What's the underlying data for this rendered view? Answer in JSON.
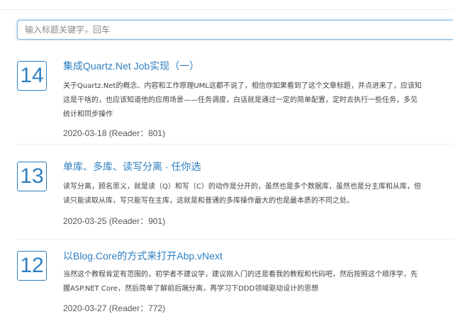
{
  "search": {
    "placeholder": "输入标题关键字，回车"
  },
  "articles": [
    {
      "number": "14",
      "title": "集成Quartz.Net Job实现（一）",
      "summary_lines": [
        "关于Quartz.Net的概念、内容和工作原理UML这都不说了，相信你如果看到了这个文章标题，并点进来了，应该知",
        "这是干啥的，也应该知道他的应用场景——任务调度，白话就是通过一定的简单配置，定时去执行一些任务，多见",
        "统计和同步操作"
      ],
      "date": "2020-03-18",
      "reader_label": "(Reader：801)"
    },
    {
      "number": "13",
      "title": "单库、多库、读写分离 · 任你选",
      "summary_lines": [
        "读写分离，顾名思义，就是读（Q）和写（C）的动作是分开的，虽然也是多个数据库，虽然也是分主库和从库，但",
        "读只能读取从库，写只能写在主库，这就是和普通的多库操作最大的也是最本质的不同之处。"
      ],
      "date": "2020-03-25",
      "reader_label": "(Reader：901)"
    },
    {
      "number": "12",
      "title": "以Blog.Core的方式来打开Abp.vNext",
      "summary_lines": [
        "当然这个教程肯定有范围的，初学者不建议学，建议刚入门的还是看我的教程和代码吧，然后按照这个顺序学，先",
        "握ASP.NET Core，然后简单了解前后端分离，再学习下DDD领域驱动设计的思想"
      ],
      "date": "2020-03-27",
      "reader_label": "(Reader：772)"
    }
  ]
}
